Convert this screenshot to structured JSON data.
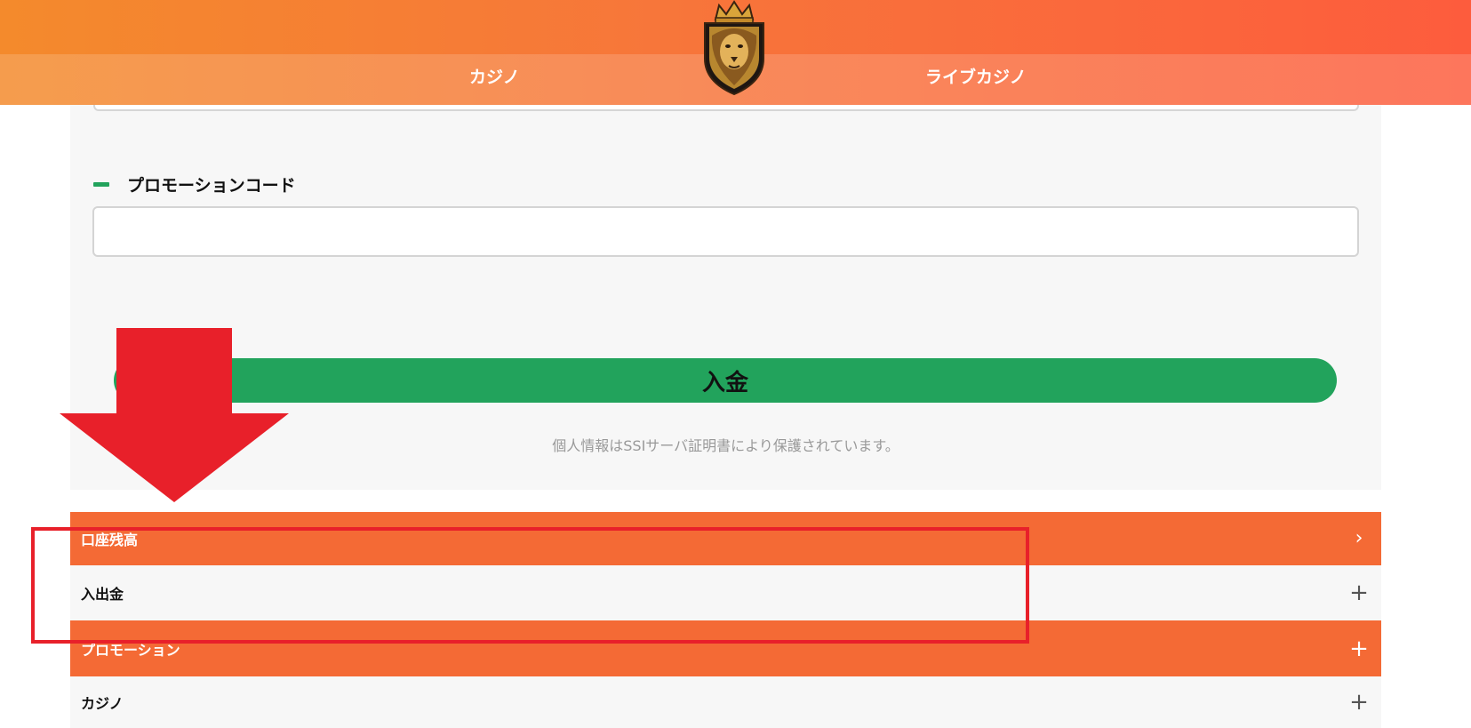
{
  "header": {
    "nav": [
      "カジノ",
      "ライブカジノ"
    ],
    "logo_icon": "lion-crown-logo",
    "colors": {
      "gradient_start": "#f48a2c",
      "gradient_end": "#fd5c3d"
    }
  },
  "form": {
    "promo_label": "プロモーションコード",
    "promo_value": "",
    "deposit_button": "入金",
    "ssl_note": "個人情報はSSIサーバ証明書により保護されています。",
    "accent_color": "#22a35c"
  },
  "menu": [
    {
      "label": "口座残高",
      "icon": "chevron-right-icon",
      "glyph": "›",
      "style": "orange"
    },
    {
      "label": "入出金",
      "icon": "plus-icon",
      "glyph": "+",
      "style": "grey"
    },
    {
      "label": "プロモーション",
      "icon": "plus-icon",
      "glyph": "+",
      "style": "orange"
    },
    {
      "label": "カジノ",
      "icon": "plus-icon",
      "glyph": "+",
      "style": "grey"
    }
  ],
  "annotations": {
    "arrow_color": "#e8202a",
    "box_color": "#e8202a"
  }
}
